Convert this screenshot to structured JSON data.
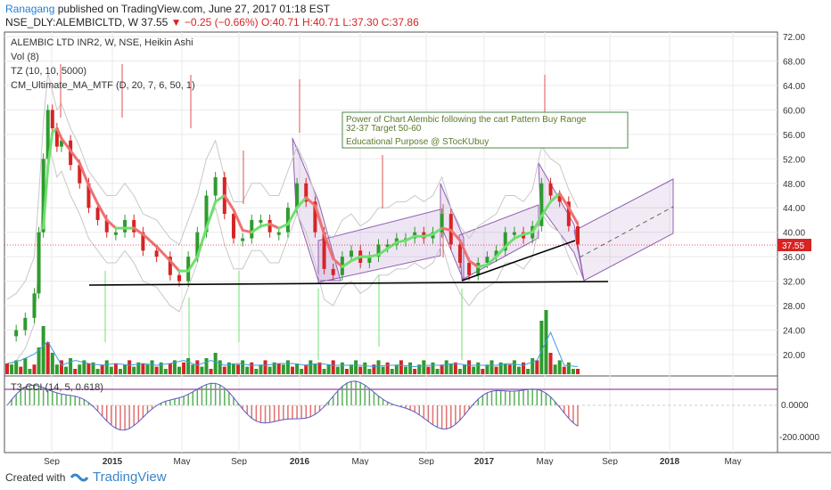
{
  "header": {
    "user": "Ranagang",
    "published_text": "published on TradingView.com, June 27, 2017 01:18 EST",
    "symbol": "NSE_DLY:ALEMBICLTD, W",
    "last": "37.55",
    "change": "−0.25 (−0.66%)",
    "ohlc": "O:40.71 H:40.71 L:37.30 C:37.86"
  },
  "legend": [
    "ALEMBIC LTD INR2, W, NSE, Heikin Ashi",
    "Vol (8)",
    "TZ (10, 10, 5000)",
    "CM_Ultimate_MA_MTF (D, 20, 7, 6, 50, 1)"
  ],
  "annotation": {
    "line1": "Power of Chart Alembic following the cart Pattern Buy Range",
    "line2": "32-37 Target 50-60",
    "line3": "Educational Purpose @ STocKUbuy"
  },
  "price_tag": "37.55",
  "cci_label": "T3-CCI (14, 5, 0.618)",
  "footer": {
    "created_with": "Created with",
    "brand": "TradingView"
  },
  "colors": {
    "up": "#2e9b2e",
    "down": "#d62424",
    "ma_up": "#6ee06e",
    "ma_down": "#f07070",
    "channel": "#a070c0"
  },
  "chart_data": {
    "type": "candlestick",
    "chart_style": "Heikin Ashi",
    "x_ticks": [
      "Sep",
      "2015",
      "May",
      "Sep",
      "2016",
      "May",
      "Sep",
      "2017",
      "May",
      "Sep",
      "2018",
      "May"
    ],
    "y_ticks": [
      "72.00",
      "68.00",
      "64.00",
      "60.00",
      "56.00",
      "52.00",
      "48.00",
      "44.00",
      "40.00",
      "36.00",
      "32.00",
      "28.00",
      "24.00",
      "20.00"
    ],
    "y_range": [
      17,
      72
    ],
    "cci_ticks": [
      "0.0000",
      "-200.0000"
    ],
    "support_level": 31.3,
    "price_series": [
      {
        "t": 0,
        "p": 23
      },
      {
        "t": 2,
        "p": 24
      },
      {
        "t": 4,
        "p": 26
      },
      {
        "t": 6,
        "p": 30
      },
      {
        "t": 7,
        "p": 40
      },
      {
        "t": 8,
        "p": 52
      },
      {
        "t": 9,
        "p": 60
      },
      {
        "t": 10,
        "p": 57
      },
      {
        "t": 11,
        "p": 54
      },
      {
        "t": 12,
        "p": 55
      },
      {
        "t": 14,
        "p": 51
      },
      {
        "t": 16,
        "p": 48
      },
      {
        "t": 18,
        "p": 44
      },
      {
        "t": 20,
        "p": 42
      },
      {
        "t": 22,
        "p": 40
      },
      {
        "t": 24,
        "p": 40
      },
      {
        "t": 26,
        "p": 42
      },
      {
        "t": 28,
        "p": 40
      },
      {
        "t": 30,
        "p": 37
      },
      {
        "t": 33,
        "p": 36
      },
      {
        "t": 36,
        "p": 33
      },
      {
        "t": 38,
        "p": 32
      },
      {
        "t": 40,
        "p": 36
      },
      {
        "t": 42,
        "p": 40
      },
      {
        "t": 44,
        "p": 46
      },
      {
        "t": 46,
        "p": 49
      },
      {
        "t": 48,
        "p": 43
      },
      {
        "t": 50,
        "p": 39
      },
      {
        "t": 52,
        "p": 39
      },
      {
        "t": 54,
        "p": 42
      },
      {
        "t": 56,
        "p": 42
      },
      {
        "t": 58,
        "p": 40
      },
      {
        "t": 60,
        "p": 40
      },
      {
        "t": 62,
        "p": 44
      },
      {
        "t": 64,
        "p": 48
      },
      {
        "t": 66,
        "p": 45
      },
      {
        "t": 68,
        "p": 40
      },
      {
        "t": 70,
        "p": 34
      },
      {
        "t": 72,
        "p": 33
      },
      {
        "t": 74,
        "p": 36
      },
      {
        "t": 76,
        "p": 37
      },
      {
        "t": 78,
        "p": 35
      },
      {
        "t": 80,
        "p": 36
      },
      {
        "t": 82,
        "p": 38
      },
      {
        "t": 84,
        "p": 38
      },
      {
        "t": 86,
        "p": 39
      },
      {
        "t": 88,
        "p": 39
      },
      {
        "t": 90,
        "p": 40
      },
      {
        "t": 92,
        "p": 39
      },
      {
        "t": 94,
        "p": 40
      },
      {
        "t": 96,
        "p": 43
      },
      {
        "t": 98,
        "p": 38
      },
      {
        "t": 100,
        "p": 35
      },
      {
        "t": 102,
        "p": 33
      },
      {
        "t": 104,
        "p": 35
      },
      {
        "t": 106,
        "p": 36
      },
      {
        "t": 108,
        "p": 37
      },
      {
        "t": 110,
        "p": 40
      },
      {
        "t": 112,
        "p": 40
      },
      {
        "t": 114,
        "p": 39
      },
      {
        "t": 116,
        "p": 41
      },
      {
        "t": 118,
        "p": 48
      },
      {
        "t": 120,
        "p": 46
      },
      {
        "t": 122,
        "p": 45
      },
      {
        "t": 124,
        "p": 41
      },
      {
        "t": 126,
        "p": 38
      }
    ],
    "volume": [
      {
        "t": 0,
        "v": 2
      },
      {
        "t": 4,
        "v": 3
      },
      {
        "t": 7,
        "v": 5
      },
      {
        "t": 8,
        "v": 9
      },
      {
        "t": 9,
        "v": 6
      },
      {
        "t": 10,
        "v": 4
      },
      {
        "t": 14,
        "v": 3
      },
      {
        "t": 18,
        "v": 2
      },
      {
        "t": 24,
        "v": 2
      },
      {
        "t": 30,
        "v": 2
      },
      {
        "t": 36,
        "v": 2
      },
      {
        "t": 40,
        "v": 3
      },
      {
        "t": 44,
        "v": 3
      },
      {
        "t": 46,
        "v": 4
      },
      {
        "t": 50,
        "v": 2
      },
      {
        "t": 60,
        "v": 2
      },
      {
        "t": 64,
        "v": 2
      },
      {
        "t": 68,
        "v": 2
      },
      {
        "t": 80,
        "v": 1
      },
      {
        "t": 90,
        "v": 1
      },
      {
        "t": 98,
        "v": 2
      },
      {
        "t": 110,
        "v": 2
      },
      {
        "t": 116,
        "v": 3
      },
      {
        "t": 118,
        "v": 10
      },
      {
        "t": 119,
        "v": 12
      },
      {
        "t": 120,
        "v": 4
      },
      {
        "t": 126,
        "v": 1
      }
    ]
  }
}
